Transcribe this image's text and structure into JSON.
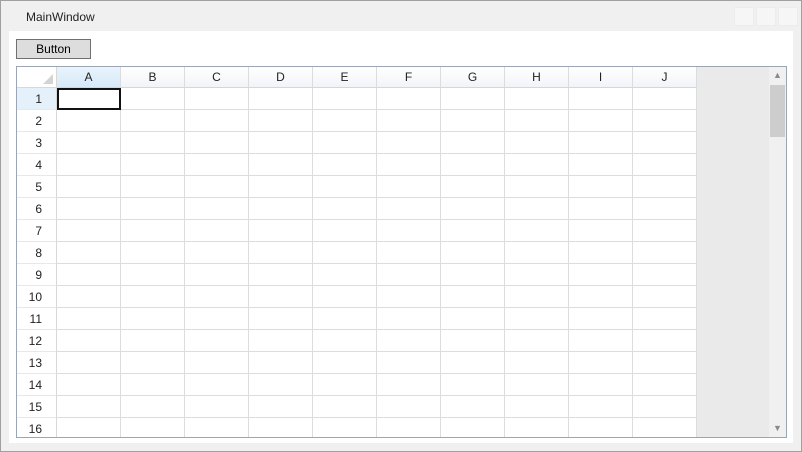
{
  "window": {
    "title": "MainWindow"
  },
  "toolbar": {
    "button_label": "Button"
  },
  "grid": {
    "columns": [
      "A",
      "B",
      "C",
      "D",
      "E",
      "F",
      "G",
      "H",
      "I",
      "J"
    ],
    "rows": [
      "1",
      "2",
      "3",
      "4",
      "5",
      "6",
      "7",
      "8",
      "9",
      "10",
      "11",
      "12",
      "13",
      "14",
      "15",
      "16"
    ],
    "selected_cell": "A1"
  },
  "icons": {
    "scroll_up": "chevron-up-icon",
    "scroll_down": "chevron-down-icon"
  }
}
